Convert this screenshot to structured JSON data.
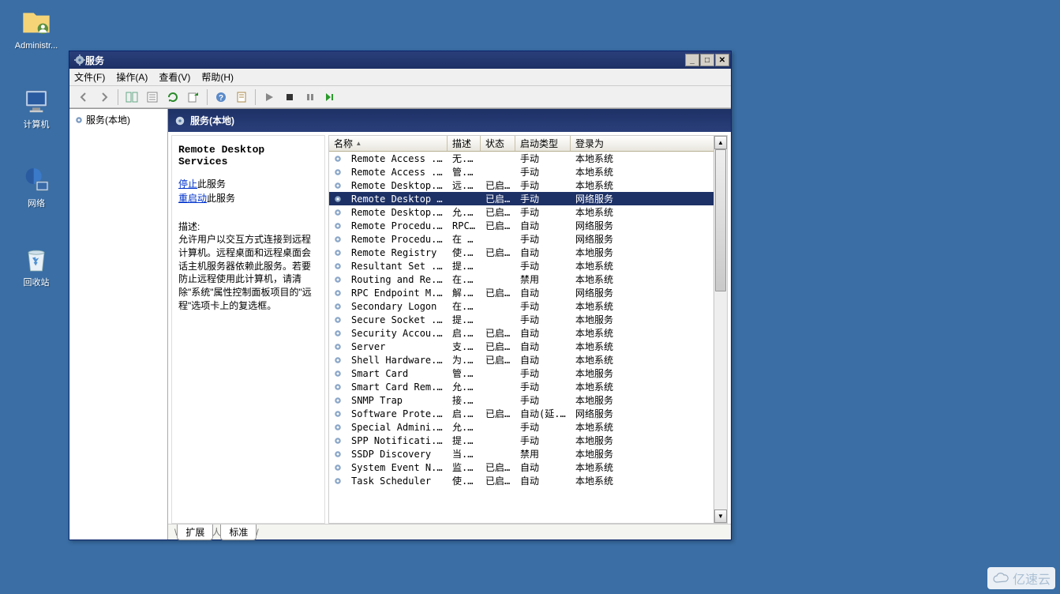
{
  "desktop": {
    "icons": [
      {
        "label": "Administr..."
      },
      {
        "label": "计算机"
      },
      {
        "label": "网络"
      },
      {
        "label": "回收站"
      }
    ]
  },
  "window": {
    "title": "服务",
    "menu": {
      "file": "文件(F)",
      "action": "操作(A)",
      "view": "查看(V)",
      "help": "帮助(H)"
    },
    "tree_root": "服务(本地)",
    "right_header": "服务(本地)",
    "detail": {
      "service_name": "Remote Desktop Services",
      "stop_link": "停止",
      "stop_suffix": "此服务",
      "restart_link": "重启动",
      "restart_suffix": "此服务",
      "desc_label": "描述:",
      "desc_text": "允许用户以交互方式连接到远程计算机。远程桌面和远程桌面会话主机服务器依赖此服务。若要防止远程使用此计算机，请清除\"系统\"属性控制面板项目的\"远程\"选项卡上的复选框。"
    },
    "columns": {
      "name": "名称",
      "desc": "描述",
      "state": "状态",
      "start": "启动类型",
      "logon": "登录为"
    },
    "sort_indicator": "▲",
    "tabs": {
      "ext": "扩展",
      "std": "标准"
    }
  },
  "services": [
    {
      "name": "Remote Access ...",
      "desc": "无...",
      "state": "",
      "start": "手动",
      "logon": "本地系统"
    },
    {
      "name": "Remote Access ...",
      "desc": "管...",
      "state": "",
      "start": "手动",
      "logon": "本地系统"
    },
    {
      "name": "Remote Desktop...",
      "desc": "远...",
      "state": "已启动",
      "start": "手动",
      "logon": "本地系统"
    },
    {
      "name": "Remote Desktop Services",
      "desc": "",
      "state": "已启动",
      "start": "手动",
      "logon": "网络服务",
      "selected": true
    },
    {
      "name": "Remote Desktop...",
      "desc": "允...",
      "state": "已启动",
      "start": "手动",
      "logon": "本地系统"
    },
    {
      "name": "Remote Procedu...",
      "desc": "RPC...",
      "state": "已启动",
      "start": "自动",
      "logon": "网络服务"
    },
    {
      "name": "Remote Procedu...",
      "desc": "在 ...",
      "state": "",
      "start": "手动",
      "logon": "网络服务"
    },
    {
      "name": "Remote Registry",
      "desc": "使...",
      "state": "已启动",
      "start": "自动",
      "logon": "本地服务"
    },
    {
      "name": "Resultant Set ...",
      "desc": "提...",
      "state": "",
      "start": "手动",
      "logon": "本地系统"
    },
    {
      "name": "Routing and Re...",
      "desc": "在...",
      "state": "",
      "start": "禁用",
      "logon": "本地系统"
    },
    {
      "name": "RPC Endpoint M...",
      "desc": "解...",
      "state": "已启动",
      "start": "自动",
      "logon": "网络服务"
    },
    {
      "name": "Secondary Logon",
      "desc": "在...",
      "state": "",
      "start": "手动",
      "logon": "本地系统"
    },
    {
      "name": "Secure Socket ...",
      "desc": "提...",
      "state": "",
      "start": "手动",
      "logon": "本地服务"
    },
    {
      "name": "Security Accou...",
      "desc": "启...",
      "state": "已启动",
      "start": "自动",
      "logon": "本地系统"
    },
    {
      "name": "Server",
      "desc": "支...",
      "state": "已启动",
      "start": "自动",
      "logon": "本地系统"
    },
    {
      "name": "Shell Hardware...",
      "desc": "为...",
      "state": "已启动",
      "start": "自动",
      "logon": "本地系统"
    },
    {
      "name": "Smart Card",
      "desc": "管...",
      "state": "",
      "start": "手动",
      "logon": "本地服务"
    },
    {
      "name": "Smart Card Rem...",
      "desc": "允...",
      "state": "",
      "start": "手动",
      "logon": "本地系统"
    },
    {
      "name": "SNMP Trap",
      "desc": "接...",
      "state": "",
      "start": "手动",
      "logon": "本地服务"
    },
    {
      "name": "Software Prote...",
      "desc": "启...",
      "state": "已启动",
      "start": "自动(延...",
      "logon": "网络服务"
    },
    {
      "name": "Special Admini...",
      "desc": "允...",
      "state": "",
      "start": "手动",
      "logon": "本地系统"
    },
    {
      "name": "SPP Notificati...",
      "desc": "提...",
      "state": "",
      "start": "手动",
      "logon": "本地服务"
    },
    {
      "name": "SSDP Discovery",
      "desc": "当...",
      "state": "",
      "start": "禁用",
      "logon": "本地服务"
    },
    {
      "name": "System Event N...",
      "desc": "监...",
      "state": "已启动",
      "start": "自动",
      "logon": "本地系统"
    },
    {
      "name": "Task Scheduler",
      "desc": "使...",
      "state": "已启动",
      "start": "自动",
      "logon": "本地系统"
    }
  ],
  "watermark": "亿速云"
}
